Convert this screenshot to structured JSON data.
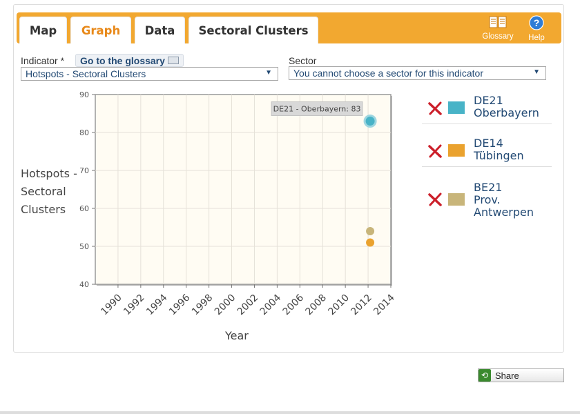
{
  "tabs": [
    {
      "label": "Map"
    },
    {
      "label": "Graph"
    },
    {
      "label": "Data"
    },
    {
      "label": "Sectoral Clusters"
    }
  ],
  "toolbar": {
    "glossary_label": "Glossary",
    "help_label": "Help",
    "glossary_icon": "book-icon",
    "help_icon": "question-icon"
  },
  "indicator": {
    "label": "Indicator *",
    "glossary_link": "Go to the glossary",
    "value": "Hotspots - Sectoral Clusters"
  },
  "sector": {
    "label": "Sector",
    "value": "You cannot choose a sector for this indicator"
  },
  "colors": {
    "accent": "#f2a830",
    "active_tab": "#e8891a",
    "plot_bg": "#fffcf3",
    "grid": "#e5e1d8",
    "de21": "#48b3c7",
    "de14": "#eaa22e",
    "be21": "#c8b57a",
    "remove": "#cc1f2a"
  },
  "legend": [
    {
      "line1": "DE21",
      "line2": "Oberbayern",
      "line3": "",
      "color": "#48b3c7"
    },
    {
      "line1": "DE14",
      "line2": "Tübingen",
      "line3": "",
      "color": "#eaa22e"
    },
    {
      "line1": "BE21",
      "line2": "Prov.",
      "line3": "Antwerpen",
      "color": "#c8b57a"
    }
  ],
  "share_label": "Share",
  "chart_data": {
    "type": "scatter",
    "xlabel": "Year",
    "ylabel": "Hotspots - Sectoral Clusters",
    "xlim": [
      1988,
      2014
    ],
    "ylim": [
      40,
      90
    ],
    "xticks": [
      1990,
      1992,
      1994,
      1996,
      1998,
      2000,
      2002,
      2004,
      2006,
      2008,
      2010,
      2012,
      2014
    ],
    "yticks": [
      40,
      50,
      60,
      70,
      80,
      90
    ],
    "grid": true,
    "series": [
      {
        "name": "DE21 Oberbayern",
        "color": "#48b3c7",
        "points": [
          {
            "x": 2012,
            "y": 83
          }
        ]
      },
      {
        "name": "DE14 Tübingen",
        "color": "#eaa22e",
        "points": [
          {
            "x": 2012,
            "y": 51
          }
        ]
      },
      {
        "name": "BE21 Prov. Antwerpen",
        "color": "#c8b57a",
        "points": [
          {
            "x": 2012,
            "y": 54
          }
        ]
      }
    ],
    "tooltip": "DE21 - Oberbayern: 83"
  }
}
